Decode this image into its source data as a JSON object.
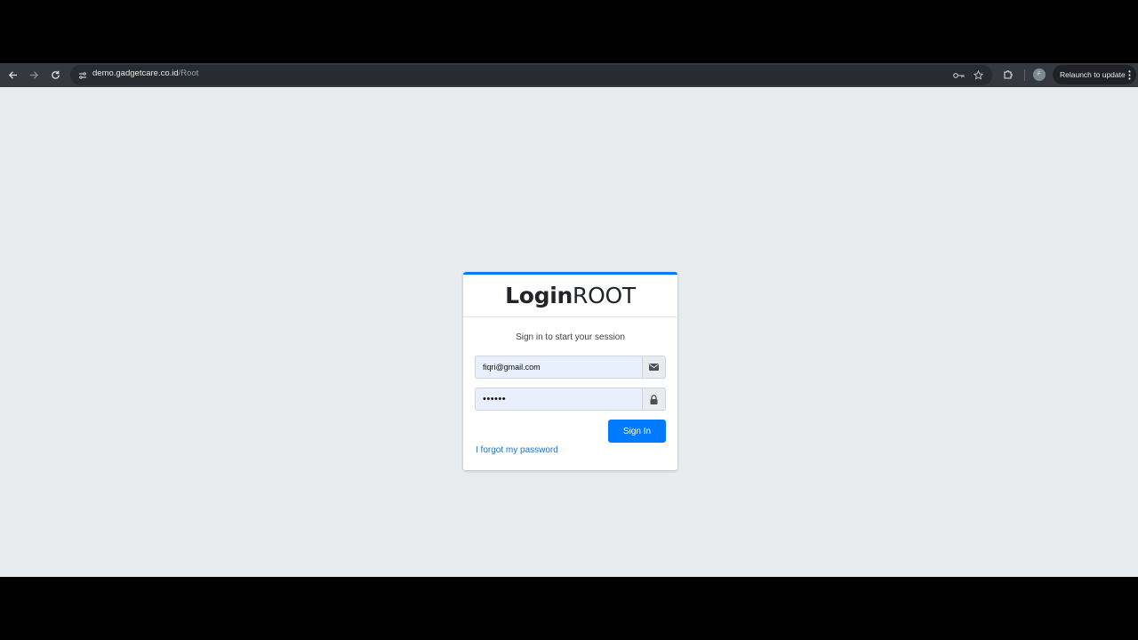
{
  "browser": {
    "url_host": "demo.gadgetcare.co.id",
    "url_path": "/Root",
    "profile_initial": "F",
    "relaunch_label": "Relaunch to update",
    "icons": [
      "back-arrow-icon",
      "forward-arrow-icon",
      "reload-icon",
      "site-settings-icon",
      "key-icon",
      "star-icon",
      "extensions-icon",
      "menu-dots-icon"
    ]
  },
  "login": {
    "brand_bold": "Login",
    "brand_light": "ROOT",
    "message": "Sign in to start your session",
    "email_value": "fiqri@gmail.com",
    "password_value": "••••••",
    "sign_in_label": "Sign In",
    "forgot_label": "I forgot my password",
    "accent_color": "#007bff"
  }
}
